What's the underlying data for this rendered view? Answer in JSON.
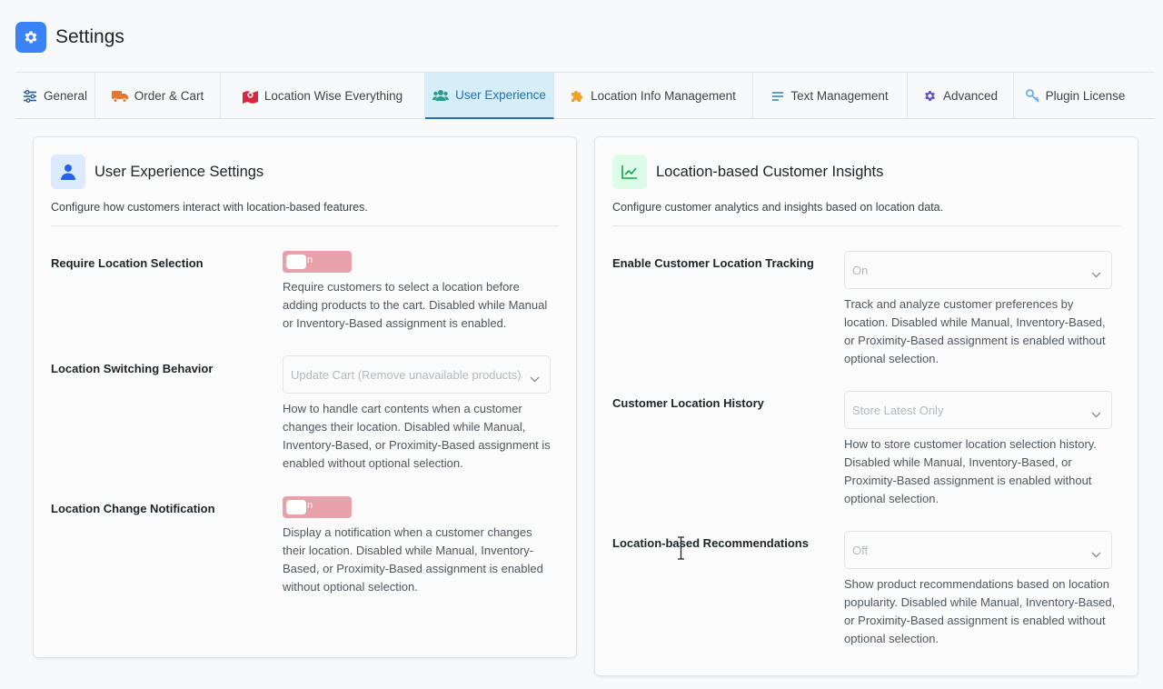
{
  "header": {
    "title": "Settings",
    "icon": "gear-icon"
  },
  "tabs": [
    {
      "label": "General",
      "icon": "sliders-icon"
    },
    {
      "label": "Order & Cart",
      "icon": "truck-icon"
    },
    {
      "label": "Location Wise Everything",
      "icon": "map-icon"
    },
    {
      "label": "User Experience",
      "icon": "users-icon",
      "active": true
    },
    {
      "label": "Location Info Management",
      "icon": "puzzle-icon"
    },
    {
      "label": "Text Management",
      "icon": "text-lines-icon"
    },
    {
      "label": "Advanced",
      "icon": "gear-icon"
    },
    {
      "label": "Plugin License",
      "icon": "key-icon"
    }
  ],
  "left_card": {
    "title": "User Experience Settings",
    "description": "Configure how customers interact with location-based features.",
    "icon": "user-icon",
    "rows": [
      {
        "label": "Require Location Selection",
        "control": "toggle",
        "toggle_text": "n",
        "help": "Require customers to select a location before adding products to the cart. Disabled while Manual or Inventory-Based assignment is enabled."
      },
      {
        "label": "Location Switching Behavior",
        "control": "select",
        "value": "Update Cart (Remove unavailable products)",
        "help": "How to handle cart contents when a customer changes their location. Disabled while Manual, Inventory-Based, or Proximity-Based assignment is enabled without optional selection."
      },
      {
        "label": "Location Change Notification",
        "control": "toggle",
        "toggle_text": "n",
        "help": "Display a notification when a customer changes their location. Disabled while Manual, Inventory-Based, or Proximity-Based assignment is enabled without optional selection."
      }
    ]
  },
  "right_card": {
    "title": "Location-based Customer Insights",
    "description": "Configure customer analytics and insights based on location data.",
    "icon": "chart-line-icon",
    "rows": [
      {
        "label": "Enable Customer Location Tracking",
        "control": "select",
        "value": "On",
        "help": "Track and analyze customer preferences by location. Disabled while Manual, Inventory-Based, or Proximity-Based assignment is enabled without optional selection."
      },
      {
        "label": "Customer Location History",
        "control": "select",
        "value": "Store Latest Only",
        "help": "How to store customer location selection history. Disabled while Manual, Inventory-Based, or Proximity-Based assignment is enabled without optional selection."
      },
      {
        "label": "Location-based Recommendations",
        "control": "select",
        "value": "Off",
        "help": "Show product recommendations based on location popularity. Disabled while Manual, Inventory-Based, or Proximity-Based assignment is enabled without optional selection."
      }
    ]
  },
  "colors": {
    "accent": "#2271b1",
    "active_tab_bg": "#d6eef8",
    "header_icon_bg": "#3b82f6",
    "toggle_disabled": "#e8a1ab"
  }
}
